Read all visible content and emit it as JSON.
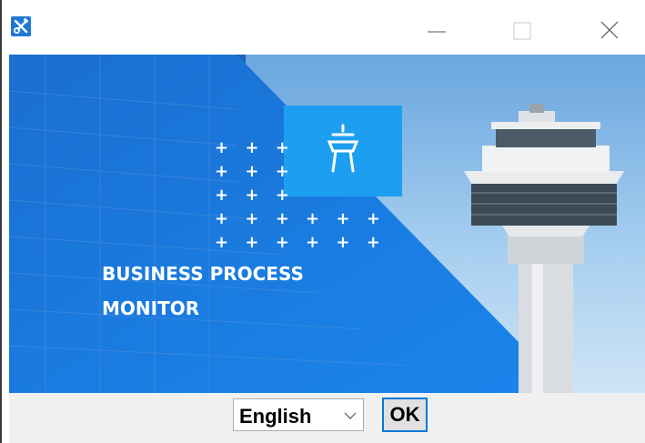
{
  "titlebar": {
    "app_icon": "tools-icon",
    "minimize_icon": "minimize-icon",
    "maximize_icon": "maximize-icon",
    "close_icon": "close-icon"
  },
  "banner": {
    "plus_rows": [
      "+ + +",
      "+ + +",
      "+ + +",
      "+ + + + + +",
      "+ + + + + +"
    ],
    "title_line1": "BUSINESS PROCESS",
    "title_line2": "MONITOR",
    "logo_icon": "control-tower-icon",
    "colors": {
      "primary_blue": "#1c7fe6",
      "tile_blue": "#1c9ff0",
      "sky": "#8fc1e9"
    }
  },
  "footer": {
    "language_selected": "English",
    "ok_label": "OK"
  }
}
